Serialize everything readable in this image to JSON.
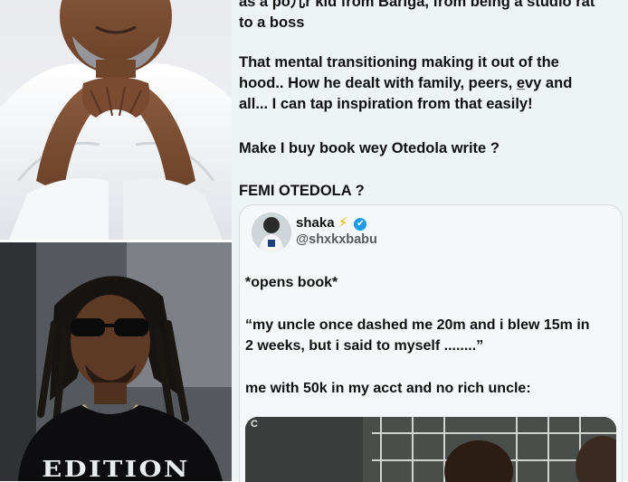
{
  "post": {
    "paragraphs": [
      "as a po⼉r kid from Bariga, from being a studio rat\nto a boss",
      "That mental transitioning making it out of the\nhood.. How he dealt with family, peers, e̲vy and\nall... I can tap inspiration from that easily!",
      "Make I buy book wey Otedola write ?",
      "FEMI OTEDOLA ?"
    ]
  },
  "quoted_tweet": {
    "display_name": "shaka",
    "bolt_emoji": "⚡",
    "verified_icon": "✔",
    "handle": "@shxkxbabu",
    "lines": [
      "*opens book*",
      "“my uncle once dashed me 20m and i blew 15m in\n2 weeks, but i said to myself ........”",
      "me with 50k in my acct and no rich uncle:"
    ],
    "image_corner_label": "C"
  },
  "photos": {
    "bottom_shirt_text": "EDITION"
  },
  "colors": {
    "verified": "#1d9bf0",
    "bolt": "#f3b300",
    "tweet_bg": "#eef3f6"
  }
}
